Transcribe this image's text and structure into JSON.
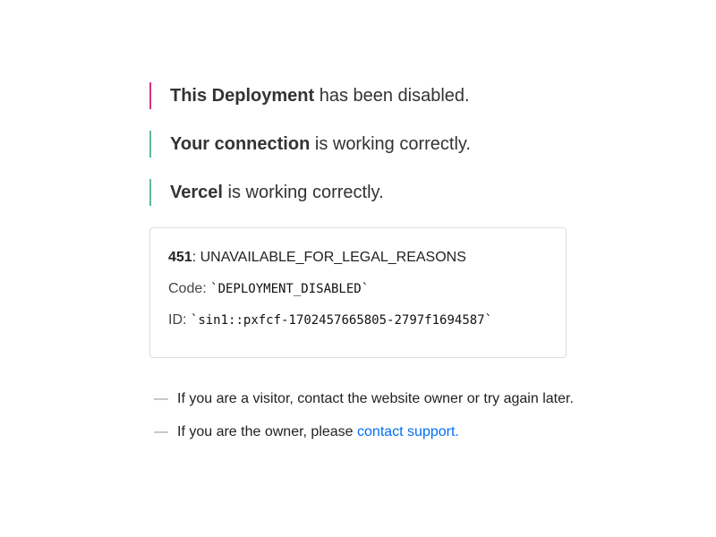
{
  "status_lines": [
    {
      "bold": "This Deployment",
      "rest": " has been disabled.",
      "bar_color": "#ff0080"
    },
    {
      "bold": "Your connection",
      "rest": " is working correctly.",
      "bar_color": "#50e3c2"
    },
    {
      "bold": "Vercel",
      "rest": " is working correctly.",
      "bar_color": "#50e3c2"
    }
  ],
  "error": {
    "status_code": "451",
    "status_text": ": UNAVAILABLE_FOR_LEGAL_REASONS",
    "code_label": "Code: ",
    "code_value": "`DEPLOYMENT_DISABLED`",
    "id_label": "ID: ",
    "id_value": "`sin1::pxfcf-1702457665805-2797f1694587`"
  },
  "help": {
    "dash": "—",
    "visitor_text": "If you are a visitor, contact the website owner or try again later.",
    "owner_text": "If you are the owner, please ",
    "owner_link": "contact support",
    "owner_link_suffix": "."
  },
  "colors": {
    "link": "#0070f3",
    "error_bar": "#ff0080",
    "ok_bar": "#50e3c2"
  }
}
